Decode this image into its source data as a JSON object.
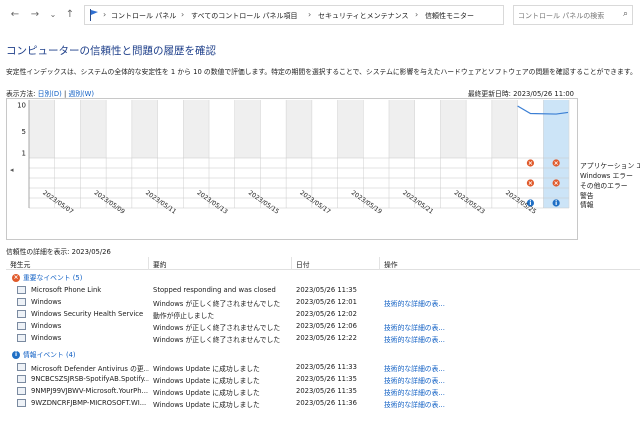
{
  "nav": {
    "breadcrumb": [
      "コントロール パネル",
      "すべてのコントロール パネル項目",
      "セキュリティとメンテナンス",
      "信頼性モニター"
    ],
    "search_placeholder": "コントロール パネルの検索"
  },
  "page": {
    "title": "コンピューターの信頼性と問題の履歴を確認",
    "description": "安定性インデックスは、システムの全体的な安定性を 1 から 10 の数値で評価します。特定の期間を選択することで、システムに影響を与えたハードウェアとソフトウェアの問題を確認することができます。",
    "view_label": "表示方法:",
    "view_days": "日別(D)",
    "view_sep": "|",
    "view_weeks": "週別(W)",
    "last_updated": "最終更新日時: 2023/05/26 11:00"
  },
  "chart_data": {
    "type": "line",
    "y_ticks": [
      "10",
      "5",
      "1"
    ],
    "ylim": [
      1,
      10
    ],
    "x": [
      "2023/05/06",
      "2023/05/07",
      "2023/05/08",
      "2023/05/09",
      "2023/05/10",
      "2023/05/11",
      "2023/05/12",
      "2023/05/13",
      "2023/05/14",
      "2023/05/15",
      "2023/05/16",
      "2023/05/17",
      "2023/05/18",
      "2023/05/19",
      "2023/05/20",
      "2023/05/21",
      "2023/05/22",
      "2023/05/23",
      "2023/05/24",
      "2023/05/25",
      "2023/05/26"
    ],
    "x_tick_labels": [
      "2023/05/07",
      "2023/05/09",
      "2023/05/11",
      "2023/05/13",
      "2023/05/15",
      "2023/05/17",
      "2023/05/19",
      "2023/05/21",
      "2023/05/23",
      "2023/05/25"
    ],
    "stability_points": [
      {
        "x": "2023/05/25",
        "y": 8.4
      },
      {
        "x": "2023/05/26",
        "y": 8.3
      }
    ],
    "selected_date": "2023/05/26",
    "legend": [
      "アプリケーション エラー",
      "Windows エラー",
      "その他のエラー",
      "警告",
      "情報"
    ],
    "event_markers": [
      {
        "date": "2023/05/25",
        "row": 0,
        "kind": "error"
      },
      {
        "date": "2023/05/25",
        "row": 2,
        "kind": "error"
      },
      {
        "date": "2023/05/25",
        "row": 4,
        "kind": "info"
      },
      {
        "date": "2023/05/26",
        "row": 0,
        "kind": "error"
      },
      {
        "date": "2023/05/26",
        "row": 2,
        "kind": "error"
      },
      {
        "date": "2023/05/26",
        "row": 4,
        "kind": "info"
      }
    ],
    "colors": {
      "line": "#3b7fd4",
      "selected": "#cce4f7",
      "error": "#e05a2b",
      "info": "#1f6fc5",
      "band": "#efefef"
    }
  },
  "details": {
    "header": "信頼性の詳細を表示: 2023/05/26",
    "columns": [
      "発生元",
      "要約",
      "日付",
      "操作"
    ],
    "groups": [
      {
        "label": "重要なイベント (5)",
        "icon": "error-icon",
        "rows": [
          {
            "source": "Microsoft Phone Link",
            "summary": "Stopped responding and was closed",
            "date": "2023/05/26 11:35",
            "action": ""
          },
          {
            "source": "Windows",
            "summary": "Windows が正しく終了されませんでした",
            "date": "2023/05/26 12:01",
            "action": "技術的な詳細の表..."
          },
          {
            "source": "Windows Security Health Service",
            "summary": "動作が停止しました",
            "date": "2023/05/26 12:02",
            "action": ""
          },
          {
            "source": "Windows",
            "summary": "Windows が正しく終了されませんでした",
            "date": "2023/05/26 12:06",
            "action": "技術的な詳細の表..."
          },
          {
            "source": "Windows",
            "summary": "Windows が正しく終了されませんでした",
            "date": "2023/05/26 12:22",
            "action": "技術的な詳細の表..."
          }
        ]
      },
      {
        "label": "情報イベント (4)",
        "icon": "info-icon",
        "rows": [
          {
            "source": "Microsoft Defender Antivirus の更...",
            "summary": "Windows Update に成功しました",
            "date": "2023/05/26 11:33",
            "action": "技術的な詳細の表..."
          },
          {
            "source": "9NCBCSZSJRSB-SpotifyAB.Spotify...",
            "summary": "Windows Update に成功しました",
            "date": "2023/05/26 11:35",
            "action": "技術的な詳細の表..."
          },
          {
            "source": "9NMPJ99VJBWV-Microsoft.YourPh...",
            "summary": "Windows Update に成功しました",
            "date": "2023/05/26 11:35",
            "action": "技術的な詳細の表..."
          },
          {
            "source": "9WZDNCRFJBMP-MICROSOFT.WI...",
            "summary": "Windows Update に成功しました",
            "date": "2023/05/26 11:36",
            "action": "技術的な詳細の表..."
          }
        ]
      }
    ]
  }
}
